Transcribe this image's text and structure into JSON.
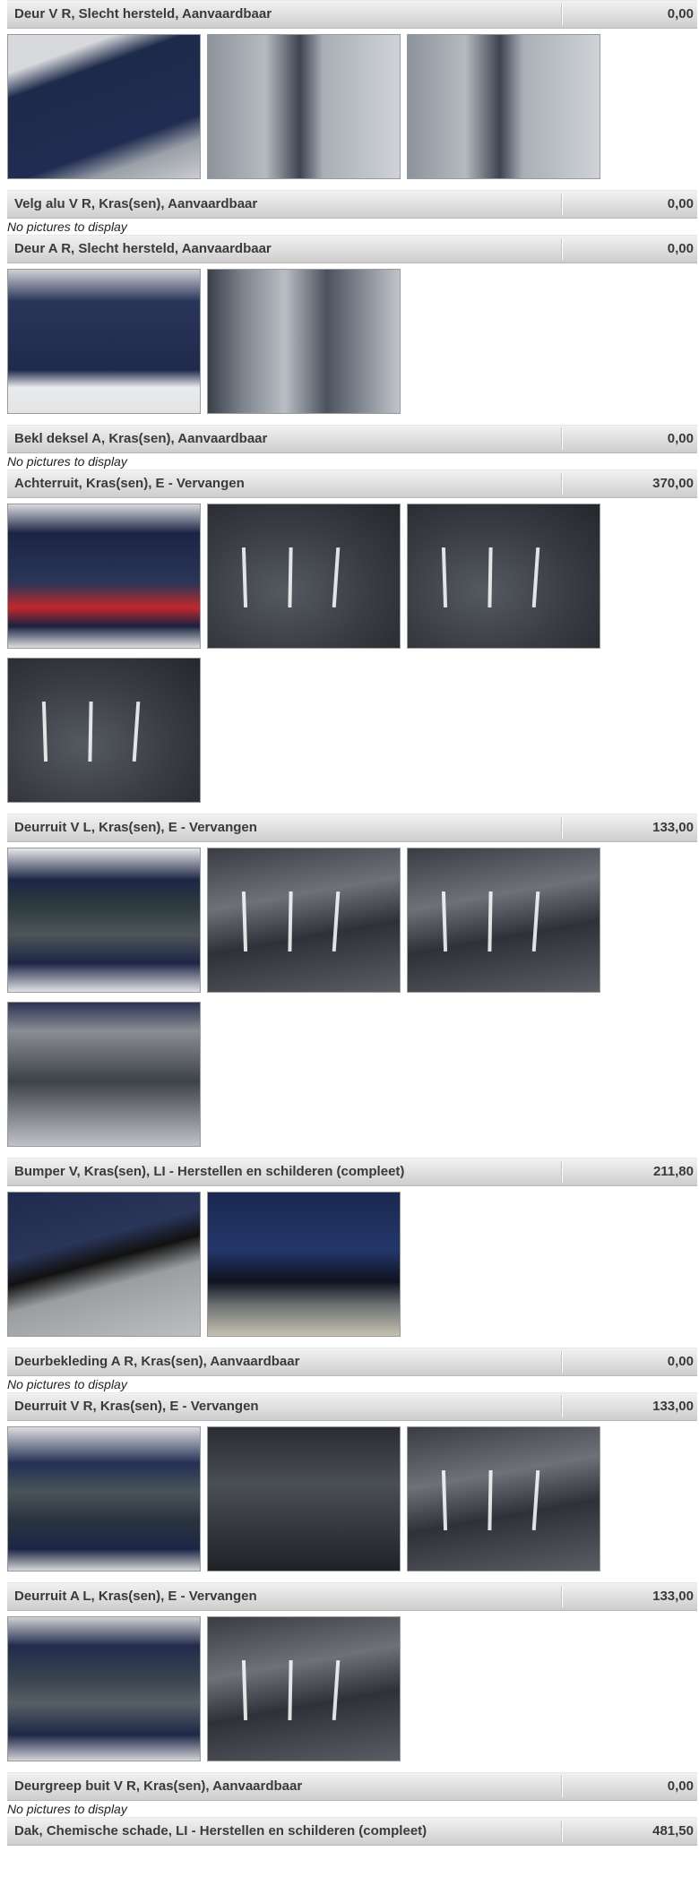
{
  "empty_text": "No pictures to display",
  "items": [
    {
      "description": "Deur V R, Slecht hersteld, Aanvaardbaar",
      "amount": "0,00",
      "photos": [
        "car-door-front-right",
        "door-panel-closeup",
        "door-panel-closeup"
      ]
    },
    {
      "description": "Velg alu V R, Kras(sen), Aanvaardbaar",
      "amount": "0,00",
      "photos": []
    },
    {
      "description": "Deur A R, Slecht hersteld, Aanvaardbaar",
      "amount": "0,00",
      "photos": [
        "car-rear-door-side",
        "door-edge-closeup"
      ]
    },
    {
      "description": "Bekl deksel A, Kras(sen), Aanvaardbaar",
      "amount": "0,00",
      "photos": []
    },
    {
      "description": "Achterruit, Kras(sen), E - Vervangen",
      "amount": "370,00",
      "photos": [
        "car-rear-window",
        "rear-glass-reflection",
        "rear-glass-reflection",
        "rear-glass-reflection"
      ]
    },
    {
      "description": "Deurruit V L, Kras(sen), E - Vervangen",
      "amount": "133,00",
      "photos": [
        "front-left-door-window",
        "window-glass-reflection",
        "window-glass-reflection",
        "window-glass-interior"
      ]
    },
    {
      "description": "Bumper V, Kras(sen), LI - Herstellen en schilderen (compleet)",
      "amount": "211,80",
      "photos": [
        "front-bumper-corner",
        "bumper-closeup-with-gauge"
      ]
    },
    {
      "description": "Deurbekleding A R, Kras(sen), Aanvaardbaar",
      "amount": "0,00",
      "photos": []
    },
    {
      "description": "Deurruit V R, Kras(sen), E - Vervangen",
      "amount": "133,00",
      "photos": [
        "front-right-door-window",
        "window-glass-dark",
        "window-glass-reflection"
      ]
    },
    {
      "description": "Deurruit A L, Kras(sen), E - Vervangen",
      "amount": "133,00",
      "photos": [
        "rear-left-door-window",
        "window-glass-reflection"
      ]
    },
    {
      "description": "Deurgreep buit V R, Kras(sen), Aanvaardbaar",
      "amount": "0,00",
      "photos": []
    },
    {
      "description": "Dak, Chemische schade, LI - Herstellen en schilderen (compleet)",
      "amount": "481,50",
      "photos": []
    }
  ]
}
